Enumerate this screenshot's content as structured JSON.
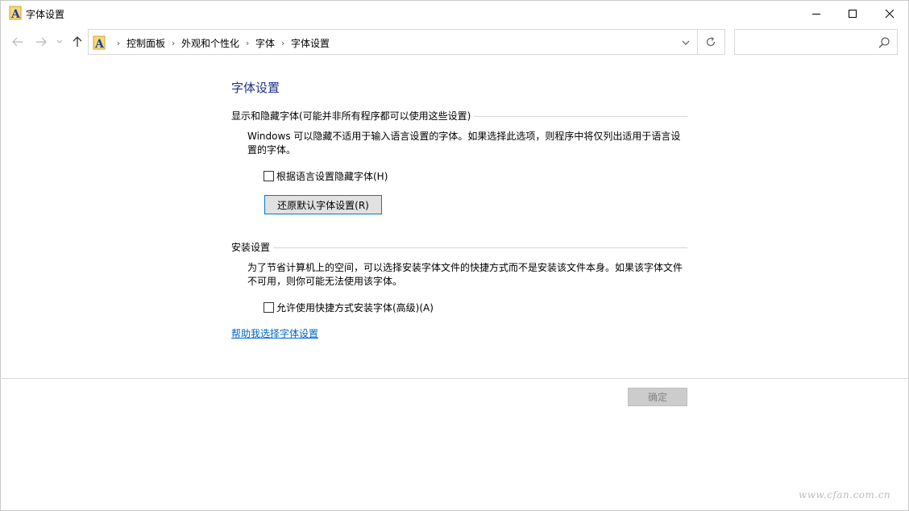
{
  "window": {
    "title": "字体设置"
  },
  "address_bar": {
    "crumbs": [
      "控制面板",
      "外观和个性化",
      "字体",
      "字体设置"
    ],
    "separator": "›"
  },
  "search": {
    "placeholder": "",
    "value": ""
  },
  "content": {
    "page_title": "字体设置",
    "show_hide_section": {
      "header": "显示和隐藏字体(可能并非所有程序都可以使用这些设置)",
      "description": "Windows 可以隐藏不适用于输入语言设置的字体。如果选择此选项，则程序中将仅列出适用于语言设置的字体。",
      "checkbox_label": "根据语言设置隐藏字体(H)",
      "checkbox_checked": false,
      "restore_button": "还原默认字体设置(R)"
    },
    "install_section": {
      "header": "安装设置",
      "description": "为了节省计算机上的空间，可以选择安装字体文件的快捷方式而不是安装该文件本身。如果该字体文件不可用，则你可能无法使用该字体。",
      "checkbox_label": "允许使用快捷方式安装字体(高级)(A)",
      "checkbox_checked": false
    },
    "help_link": "帮助我选择字体设置"
  },
  "footer": {
    "ok_button": "确定"
  },
  "watermark": "www.cfan.com.cn",
  "colors": {
    "title_blue": "#1e3287",
    "link_blue": "#0066cc",
    "focus_border": "#0078d7"
  }
}
